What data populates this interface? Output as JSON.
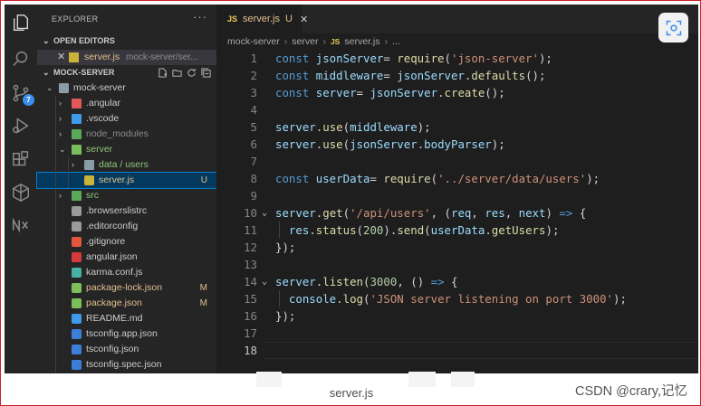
{
  "activity_bar": {
    "scm_badge": "7",
    "icons": [
      "files-icon",
      "search-icon",
      "source-control-icon",
      "run-debug-icon",
      "extensions-icon",
      "angular-icon",
      "nx-console-icon"
    ]
  },
  "sidebar": {
    "title": "EXPLORER",
    "more": "···",
    "open_editors_title": "OPEN EDITORS",
    "open_editor": {
      "name": "server.js",
      "path": "mock-server/ser..."
    },
    "project_title": "MOCK-SERVER",
    "tree": [
      {
        "label": "mock-server",
        "kind": "folder-open",
        "indent": 0,
        "chev": "⌄",
        "mark": ""
      },
      {
        "label": ".angular",
        "kind": "folder-red",
        "indent": 1,
        "chev": "›",
        "mark": ""
      },
      {
        "label": ".vscode",
        "kind": "folder-blue",
        "indent": 1,
        "chev": "›",
        "mark": ""
      },
      {
        "label": "node_modules",
        "kind": "folder-green",
        "indent": 1,
        "chev": "›",
        "mark": "",
        "dim": true
      },
      {
        "label": "server",
        "kind": "folder-open-green",
        "indent": 1,
        "chev": "⌄",
        "mark": ""
      },
      {
        "label": "data / users",
        "kind": "folder-plain",
        "indent": 2,
        "chev": "›",
        "mark": ""
      },
      {
        "label": "server.js",
        "kind": "js",
        "indent": 2,
        "chev": "",
        "mark": "U",
        "selected": true
      },
      {
        "label": "src",
        "kind": "folder-green",
        "indent": 1,
        "chev": "›",
        "mark": ""
      },
      {
        "label": ".browserslistrc",
        "kind": "gear",
        "indent": 1,
        "chev": "",
        "mark": ""
      },
      {
        "label": ".editorconfig",
        "kind": "gear",
        "indent": 1,
        "chev": "",
        "mark": ""
      },
      {
        "label": ".gitignore",
        "kind": "git",
        "indent": 1,
        "chev": "",
        "mark": ""
      },
      {
        "label": "angular.json",
        "kind": "angular",
        "indent": 1,
        "chev": "",
        "mark": ""
      },
      {
        "label": "karma.conf.js",
        "kind": "karma",
        "indent": 1,
        "chev": "",
        "mark": ""
      },
      {
        "label": "package-lock.json",
        "kind": "npm",
        "indent": 1,
        "chev": "",
        "mark": "M"
      },
      {
        "label": "package.json",
        "kind": "npm",
        "indent": 1,
        "chev": "",
        "mark": "M"
      },
      {
        "label": "README.md",
        "kind": "info",
        "indent": 1,
        "chev": "",
        "mark": ""
      },
      {
        "label": "tsconfig.app.json",
        "kind": "ts",
        "indent": 1,
        "chev": "",
        "mark": ""
      },
      {
        "label": "tsconfig.json",
        "kind": "ts",
        "indent": 1,
        "chev": "",
        "mark": ""
      },
      {
        "label": "tsconfig.spec.json",
        "kind": "ts",
        "indent": 1,
        "chev": "",
        "mark": ""
      }
    ]
  },
  "tab": {
    "icon": "JS",
    "name": "server.js",
    "status": "U",
    "close": "✕"
  },
  "breadcrumb": [
    "mock-server",
    "server",
    "server.js",
    "..."
  ],
  "code_lines": [
    {
      "n": "1",
      "fold": "",
      "tokens": [
        [
          "kw",
          "const "
        ],
        [
          "var",
          "jsonServer"
        ],
        [
          "",
          "= "
        ],
        [
          "fn",
          "require"
        ],
        [
          "",
          "("
        ],
        [
          "str",
          "'json-server'"
        ],
        [
          "",
          ");"
        ]
      ]
    },
    {
      "n": "2",
      "fold": "",
      "tokens": [
        [
          "kw",
          "const "
        ],
        [
          "var",
          "middleware"
        ],
        [
          "",
          ""
        ],
        [
          "",
          "= "
        ],
        [
          "var",
          "jsonServer"
        ],
        [
          "",
          "."
        ],
        [
          "fn",
          "defaults"
        ],
        [
          "",
          "();"
        ]
      ]
    },
    {
      "n": "3",
      "fold": "",
      "tokens": [
        [
          "kw",
          "const "
        ],
        [
          "var",
          "server"
        ],
        [
          "",
          "= "
        ],
        [
          "var",
          "jsonServer"
        ],
        [
          "",
          "."
        ],
        [
          "fn",
          "create"
        ],
        [
          "",
          "();"
        ]
      ]
    },
    {
      "n": "4",
      "fold": "",
      "tokens": []
    },
    {
      "n": "5",
      "fold": "",
      "tokens": [
        [
          "var",
          "server"
        ],
        [
          "",
          "."
        ],
        [
          "fn",
          "use"
        ],
        [
          "",
          "("
        ],
        [
          "var",
          "middleware"
        ],
        [
          "",
          ");"
        ]
      ]
    },
    {
      "n": "6",
      "fold": "",
      "tokens": [
        [
          "var",
          "server"
        ],
        [
          "",
          "."
        ],
        [
          "fn",
          "use"
        ],
        [
          "",
          "("
        ],
        [
          "var",
          "jsonServer"
        ],
        [
          "",
          "."
        ],
        [
          "var",
          "bodyParser"
        ],
        [
          "",
          ");"
        ]
      ]
    },
    {
      "n": "7",
      "fold": "",
      "tokens": []
    },
    {
      "n": "8",
      "fold": "",
      "tokens": [
        [
          "kw",
          "const "
        ],
        [
          "var",
          "userData"
        ],
        [
          "",
          "= "
        ],
        [
          "fn",
          "require"
        ],
        [
          "",
          "("
        ],
        [
          "str",
          "'../server/data/users'"
        ],
        [
          "",
          ");"
        ]
      ]
    },
    {
      "n": "9",
      "fold": "",
      "tokens": []
    },
    {
      "n": "10",
      "fold": "⌄",
      "tokens": [
        [
          "var",
          "server"
        ],
        [
          "",
          "."
        ],
        [
          "fn",
          "get"
        ],
        [
          "",
          "("
        ],
        [
          "str",
          "'/api/users'"
        ],
        [
          "",
          ", ("
        ],
        [
          "var",
          "req"
        ],
        [
          "",
          ", "
        ],
        [
          "var",
          "res"
        ],
        [
          "",
          ", "
        ],
        [
          "var",
          "next"
        ],
        [
          "",
          ") "
        ],
        [
          "kw",
          "=>"
        ],
        [
          "",
          " {"
        ]
      ]
    },
    {
      "n": "11",
      "fold": "",
      "tokens": [
        [
          "",
          "  "
        ],
        [
          "var",
          "res"
        ],
        [
          "",
          "."
        ],
        [
          "fn",
          "status"
        ],
        [
          "",
          "("
        ],
        [
          "num",
          "200"
        ],
        [
          "",
          ")."
        ],
        [
          "fn",
          "send"
        ],
        [
          "",
          "("
        ],
        [
          "var",
          "userData"
        ],
        [
          "",
          "."
        ],
        [
          "fn",
          "getUsers"
        ],
        [
          "",
          ");"
        ]
      ]
    },
    {
      "n": "12",
      "fold": "",
      "tokens": [
        [
          "",
          "});"
        ]
      ]
    },
    {
      "n": "13",
      "fold": "",
      "tokens": []
    },
    {
      "n": "14",
      "fold": "⌄",
      "tokens": [
        [
          "var",
          "server"
        ],
        [
          "",
          "."
        ],
        [
          "fn",
          "listen"
        ],
        [
          "",
          "("
        ],
        [
          "num",
          "3000"
        ],
        [
          "",
          ", () "
        ],
        [
          "kw",
          "=>"
        ],
        [
          "",
          " {"
        ]
      ]
    },
    {
      "n": "15",
      "fold": "",
      "tokens": [
        [
          "",
          "  "
        ],
        [
          "var",
          "console"
        ],
        [
          "",
          "."
        ],
        [
          "fn",
          "log"
        ],
        [
          "",
          "("
        ],
        [
          "str",
          "'JSON server listening on port 3000'"
        ],
        [
          "",
          ");"
        ]
      ]
    },
    {
      "n": "16",
      "fold": "",
      "tokens": [
        [
          "",
          "});"
        ]
      ]
    },
    {
      "n": "17",
      "fold": "",
      "tokens": []
    },
    {
      "n": "18",
      "fold": "",
      "tokens": [],
      "active": true
    }
  ],
  "caption": "server.js",
  "watermark": "CSDN @crary,记忆",
  "colors": {
    "selection": "#04395e",
    "accent": "#007fd4",
    "untracked": "#e2c08d",
    "modified": "#e2c08d"
  }
}
